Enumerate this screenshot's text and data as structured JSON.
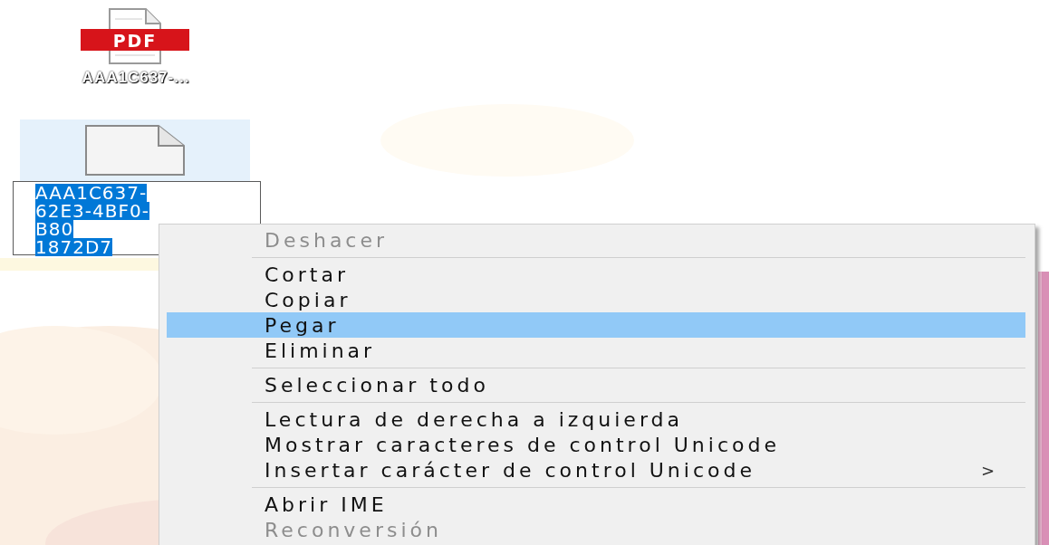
{
  "desktop_icons": [
    {
      "kind": "pdf",
      "label": "AAA1C637-...",
      "selected": false,
      "badge": "PDF"
    },
    {
      "kind": "blank",
      "selected": true,
      "rename_lines": [
        "AAA1C637-",
        "62E3-4BF0-",
        "B80",
        "1872D7"
      ]
    }
  ],
  "context_menu": {
    "items": [
      {
        "kind": "item",
        "label": "Deshacer",
        "disabled": true,
        "selected": false
      },
      {
        "kind": "separator"
      },
      {
        "kind": "item",
        "label": "Cortar",
        "disabled": false,
        "selected": false
      },
      {
        "kind": "item",
        "label": "Copiar",
        "disabled": false,
        "selected": false
      },
      {
        "kind": "item",
        "label": "Pegar",
        "disabled": false,
        "selected": true
      },
      {
        "kind": "item",
        "label": "Eliminar",
        "disabled": false,
        "selected": false
      },
      {
        "kind": "separator"
      },
      {
        "kind": "item",
        "label": "Seleccionar todo",
        "disabled": false,
        "selected": false
      },
      {
        "kind": "separator"
      },
      {
        "kind": "item",
        "label": "Lectura de derecha a izquierda",
        "disabled": false,
        "selected": false
      },
      {
        "kind": "item",
        "label": "Mostrar caracteres de control Unicode",
        "disabled": false,
        "selected": false
      },
      {
        "kind": "item",
        "label": "Insertar carácter de control Unicode",
        "disabled": false,
        "selected": false,
        "submenu_arrow": ">"
      },
      {
        "kind": "separator"
      },
      {
        "kind": "item",
        "label": "Abrir IME",
        "disabled": false,
        "selected": false
      },
      {
        "kind": "item",
        "label": "Reconversión",
        "disabled": true,
        "selected": false
      }
    ]
  }
}
